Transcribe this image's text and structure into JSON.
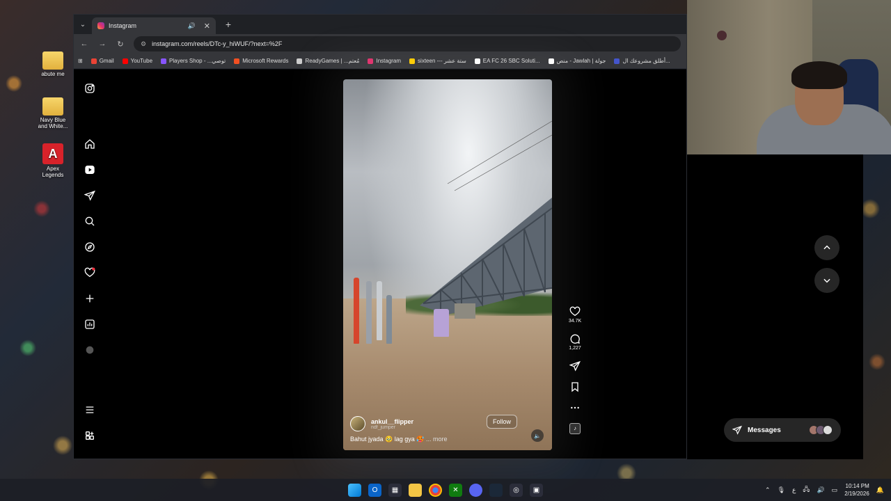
{
  "desktop": {
    "icons": [
      {
        "label": "abute me"
      },
      {
        "label": "Navy Blue and White..."
      },
      {
        "label": "Apex Legends"
      }
    ]
  },
  "browser": {
    "tab": {
      "title": "Instagram"
    },
    "url": "instagram.com/reels/DTc-y_hiWUF/?next=%2F",
    "bookmarks": [
      {
        "label": "Gmail",
        "color": "#ea4335"
      },
      {
        "label": "YouTube",
        "color": "#ff0000"
      },
      {
        "label": "Players Shop - ...توصي",
        "color": "#8855ff"
      },
      {
        "label": "Microsoft Rewards",
        "color": "#f25022"
      },
      {
        "label": "ReadyGames | ...مُعتم",
        "color": "#cccccc"
      },
      {
        "label": "Instagram",
        "color": "#e1306c"
      },
      {
        "label": "sixteen --- ستة عشر",
        "color": "#ffcc00"
      },
      {
        "label": "EA FC 26 SBC Soluti...",
        "color": "#ffffff"
      },
      {
        "label": "منص - Jawlah | جولة",
        "color": "#ffffff"
      },
      {
        "label": "أطلق مشروعك ال...",
        "color": "#4455cc"
      }
    ]
  },
  "reel": {
    "author": "ankul__flipper",
    "author_sub": "ndf_jumper",
    "follow_label": "Follow",
    "caption": "Bahut jyada 🥹 lag gya 🥵",
    "more_label": "... more",
    "likes": "34.7K",
    "comments": "1,227"
  },
  "messages": {
    "label": "Messages"
  },
  "taskbar": {
    "time": "10:14 PM",
    "date": "2/19/2026",
    "lang": "ع"
  }
}
